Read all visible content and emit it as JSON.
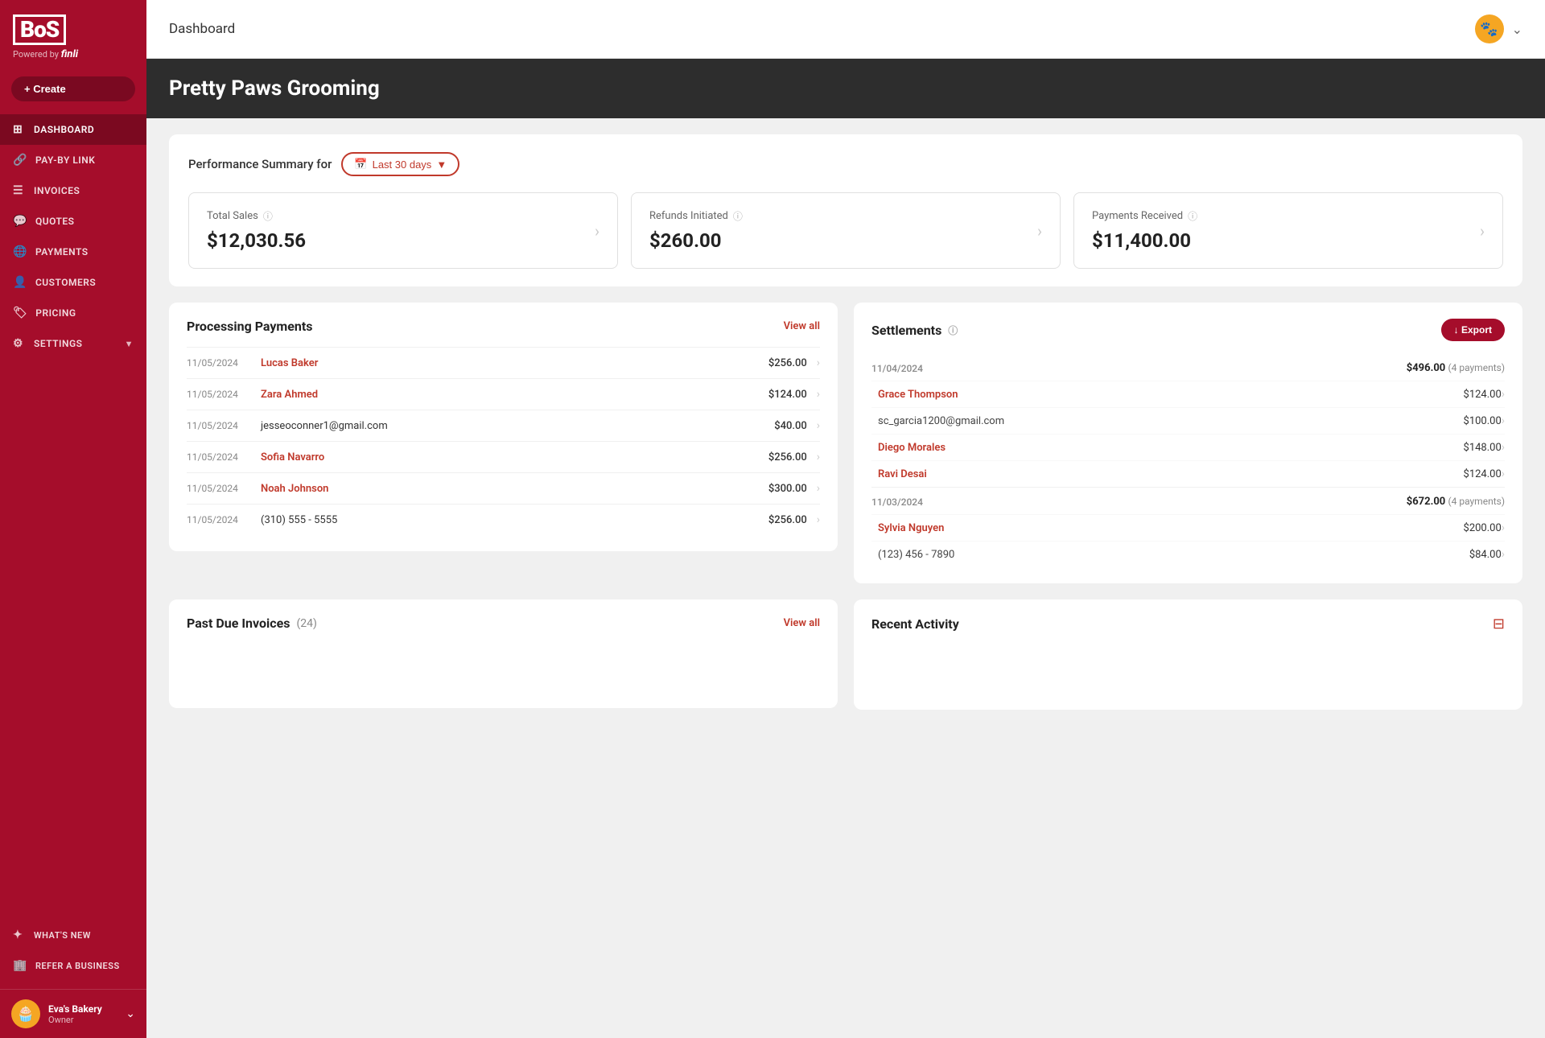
{
  "sidebar": {
    "logo": "BoS",
    "powered_by": "Powered by",
    "finli": "finli",
    "create_label": "+ Create",
    "nav_items": [
      {
        "id": "dashboard",
        "label": "DASHBOARD",
        "icon": "⊞",
        "active": true
      },
      {
        "id": "pay-by-link",
        "label": "PAY-BY LINK",
        "icon": "🔗",
        "active": false
      },
      {
        "id": "invoices",
        "label": "INVOICES",
        "icon": "☰",
        "active": false
      },
      {
        "id": "quotes",
        "label": "QUOTES",
        "icon": "💬",
        "active": false
      },
      {
        "id": "payments",
        "label": "PAYMENTS",
        "icon": "🌐",
        "active": false
      },
      {
        "id": "customers",
        "label": "CUSTOMERS",
        "icon": "👤",
        "active": false
      },
      {
        "id": "pricing",
        "label": "PRICING",
        "icon": "🏷",
        "active": false
      },
      {
        "id": "settings",
        "label": "SETTINGS",
        "icon": "⚙",
        "active": false
      }
    ],
    "bottom_items": [
      {
        "id": "whats-new",
        "label": "WHAT'S NEW",
        "icon": "✦"
      },
      {
        "id": "refer-a-business",
        "label": "REFER A BUSINESS",
        "icon": "🏢"
      }
    ],
    "user": {
      "name": "Eva's Bakery",
      "role": "Owner",
      "avatar_icon": "🧁"
    }
  },
  "topbar": {
    "title": "Dashboard",
    "paw_icon": "🐾"
  },
  "business": {
    "name": "Pretty Paws Grooming"
  },
  "performance": {
    "label": "Performance Summary for",
    "date_filter": "Last 30 days",
    "metrics": [
      {
        "label": "Total Sales",
        "value": "$12,030.56"
      },
      {
        "label": "Refunds Initiated",
        "value": "$260.00"
      },
      {
        "label": "Payments Received",
        "value": "$11,400.00"
      }
    ]
  },
  "processing_payments": {
    "title": "Processing Payments",
    "view_all": "View all",
    "rows": [
      {
        "date": "11/05/2024",
        "name": "Lucas Baker",
        "amount": "$256.00",
        "linked": true
      },
      {
        "date": "11/05/2024",
        "name": "Zara Ahmed",
        "amount": "$124.00",
        "linked": true
      },
      {
        "date": "11/05/2024",
        "name": "jesseoconner1@gmail.com",
        "amount": "$40.00",
        "linked": false
      },
      {
        "date": "11/05/2024",
        "name": "Sofia Navarro",
        "amount": "$256.00",
        "linked": true
      },
      {
        "date": "11/05/2024",
        "name": "Noah Johnson",
        "amount": "$300.00",
        "linked": true
      },
      {
        "date": "11/05/2024",
        "name": "(310) 555 - 5555",
        "amount": "$256.00",
        "linked": false
      }
    ]
  },
  "settlements": {
    "title": "Settlements",
    "export_label": "↓ Export",
    "groups": [
      {
        "date": "11/04/2024",
        "total": "$496.00",
        "total_sub": "(4 payments)",
        "rows": [
          {
            "name": "Grace Thompson",
            "amount": "$124.00",
            "linked": true
          },
          {
            "name": "sc_garcia1200@gmail.com",
            "amount": "$100.00",
            "linked": false
          },
          {
            "name": "Diego Morales",
            "amount": "$148.00",
            "linked": true
          },
          {
            "name": "Ravi Desai",
            "amount": "$124.00",
            "linked": true
          }
        ]
      },
      {
        "date": "11/03/2024",
        "total": "$672.00",
        "total_sub": "(4 payments)",
        "rows": [
          {
            "name": "Sylvia Nguyen",
            "amount": "$200.00",
            "linked": true
          },
          {
            "name": "(123) 456 - 7890",
            "amount": "$84.00",
            "linked": false
          }
        ]
      }
    ]
  },
  "past_due_invoices": {
    "title": "Past Due Invoices",
    "count": "(24)",
    "view_all": "View all"
  },
  "recent_activity": {
    "title": "Recent Activity"
  }
}
